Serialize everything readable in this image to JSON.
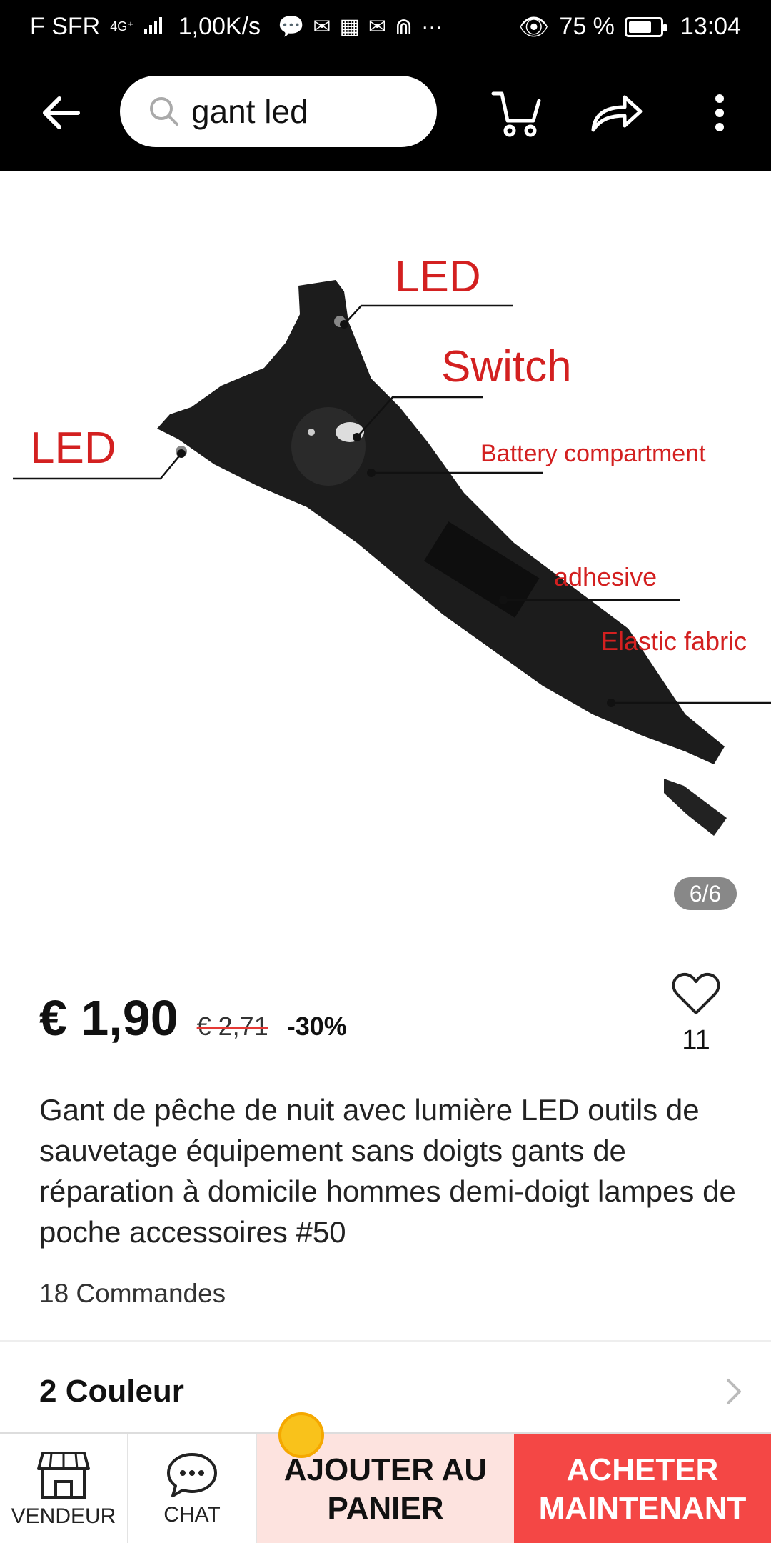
{
  "status_bar": {
    "carrier": "F SFR",
    "network": "4G⁺",
    "speed": "1,00K/s",
    "battery": "75 %",
    "battery_level": 0.75,
    "time": "13:04"
  },
  "search": {
    "query": "gant led"
  },
  "image": {
    "labels": {
      "led_top": "LED",
      "switch": "Switch",
      "led_left": "LED",
      "battery": "Battery compartment",
      "adhesive": "adhesive",
      "elastic": "Elastic fabric"
    },
    "counter": "6/6"
  },
  "product": {
    "price": "€ 1,90",
    "old_price": "€ 2,71",
    "discount": "-30%",
    "wish_count": "11",
    "title": "Gant de pêche de nuit avec lumière LED outils de sauvetage équipement sans doigts gants de réparation à domicile hommes demi-doigt lampes de poche accessoires #50",
    "orders": "18 Commandes",
    "colors": "2 Couleur"
  },
  "bottom_bar": {
    "vendor": "VENDEUR",
    "chat": "CHAT",
    "add_line1": "AJOUTER AU",
    "add_line2": "PANIER",
    "buy_line1": "ACHETER",
    "buy_line2": "MAINTENANT"
  },
  "colors": {
    "accent": "#f44745",
    "cart_bg": "#fde3df",
    "label_red": "#d32020"
  },
  "icons": [
    "back-arrow-icon",
    "search-icon",
    "cart-icon",
    "share-icon",
    "more-icon",
    "heart-icon",
    "chevron-right-icon",
    "store-icon",
    "chat-icon",
    "coin-icon"
  ]
}
